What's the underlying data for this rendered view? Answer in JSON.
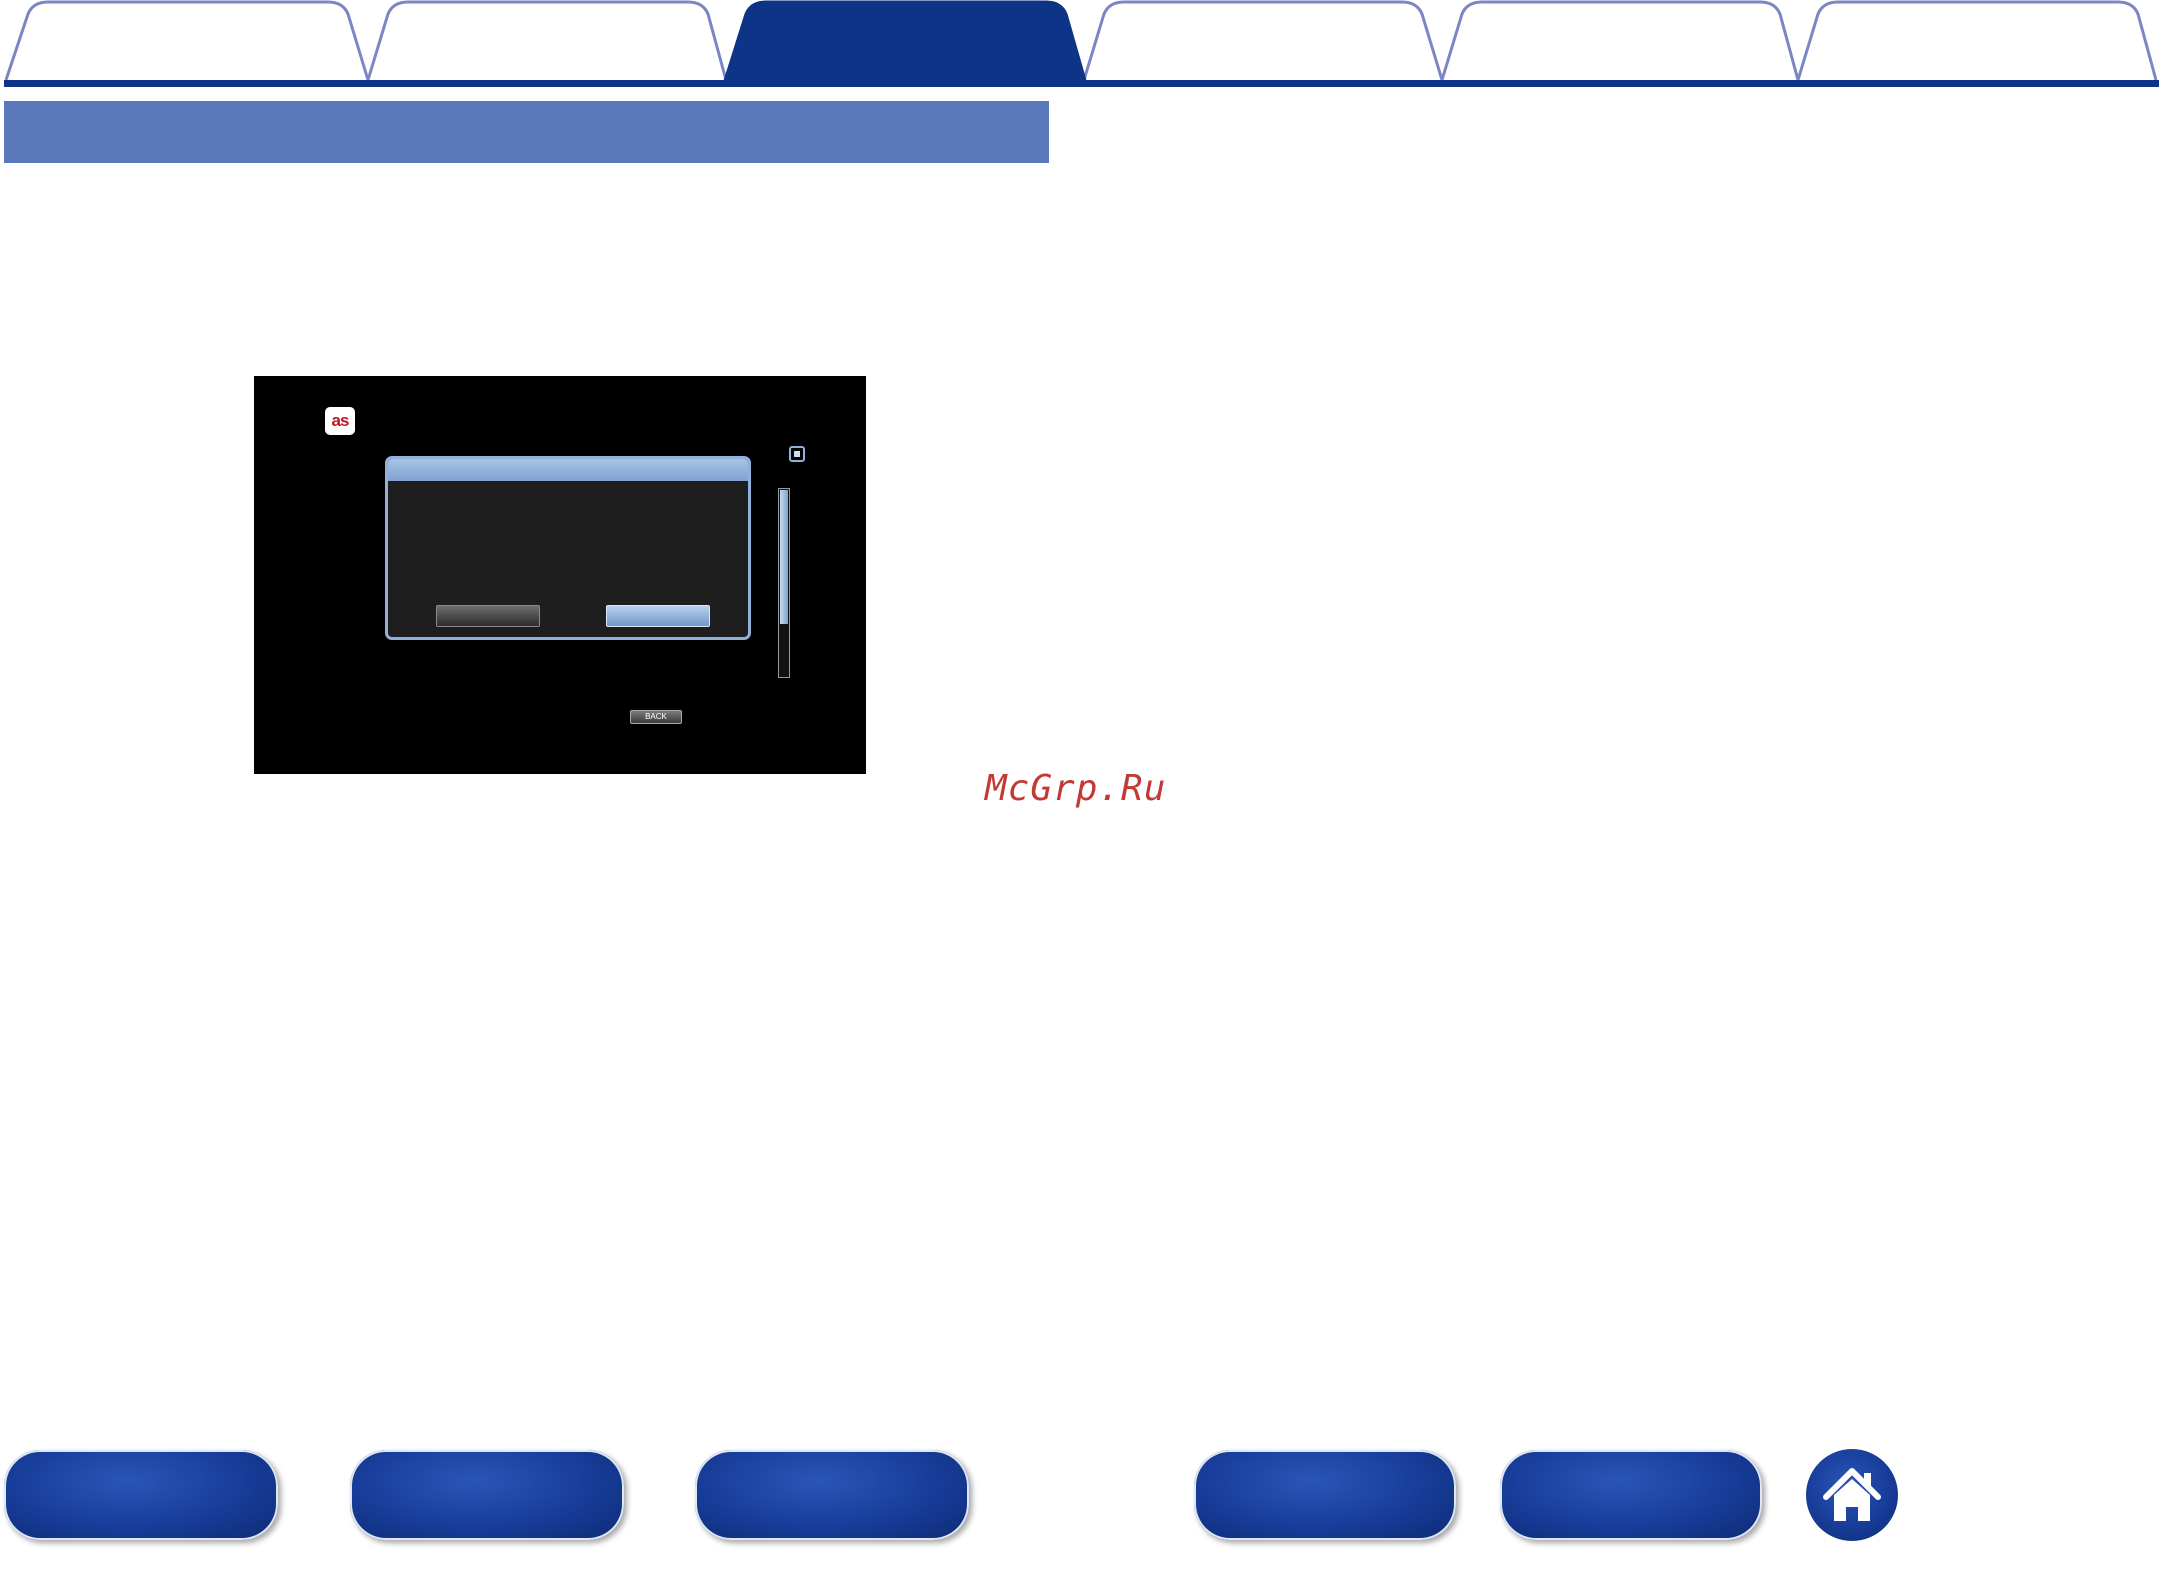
{
  "tabs": [
    {
      "label": "",
      "active": false
    },
    {
      "label": "",
      "active": false
    },
    {
      "label": "",
      "active": true
    },
    {
      "label": "",
      "active": false
    },
    {
      "label": "",
      "active": false
    },
    {
      "label": "",
      "active": false
    }
  ],
  "colors": {
    "tab_outline": "#7b86c4",
    "tab_active": "#0e3488",
    "tab_rule": "#0e3488",
    "section_band": "#5a79bb",
    "nav_button": "#173d99",
    "watermark": "#c23a33"
  },
  "screen": {
    "service_icon": "as",
    "back_key_label": "BACK",
    "scroll_position": 0.72
  },
  "watermark": "McGrp.Ru",
  "bottom_nav": {
    "buttons": [
      "",
      "",
      "",
      "",
      ""
    ],
    "home_icon": "home-icon"
  }
}
